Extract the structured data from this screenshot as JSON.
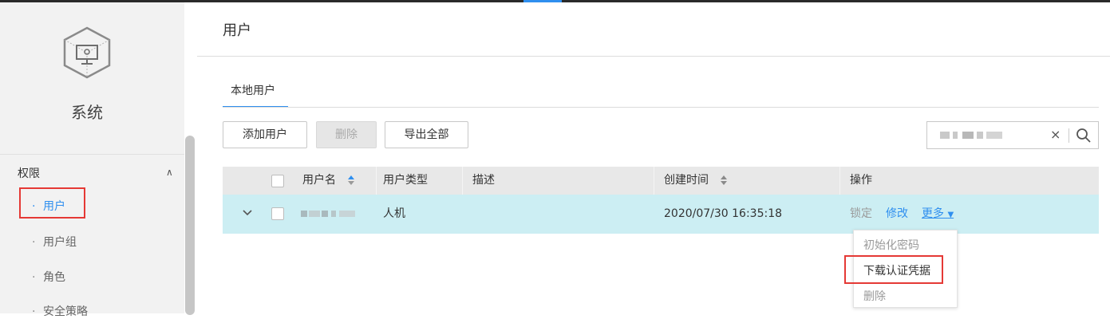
{
  "sidebar": {
    "system_title": "系统",
    "group_label": "权限",
    "items": [
      {
        "label": "用户",
        "active": true
      },
      {
        "label": "用户组",
        "active": false
      },
      {
        "label": "角色",
        "active": false
      },
      {
        "label": "安全策略",
        "active": false
      }
    ]
  },
  "page": {
    "title": "用户",
    "tab_label": "本地用户"
  },
  "toolbar": {
    "add_label": "添加用户",
    "delete_label": "删除",
    "export_label": "导出全部"
  },
  "search": {
    "value": "",
    "clear_icon": "×"
  },
  "table": {
    "headers": [
      "用户名",
      "用户类型",
      "描述",
      "创建时间",
      "操作"
    ],
    "rows": [
      {
        "username": "",
        "type": "人机",
        "description": "",
        "created": "2020/07/30 16:35:18",
        "ops": {
          "lock": "锁定",
          "edit": "修改",
          "more": "更多"
        }
      }
    ]
  },
  "more_menu": {
    "items": [
      {
        "label": "初始化密码",
        "enabled": false
      },
      {
        "label": "下载认证凭据",
        "enabled": true
      },
      {
        "label": "删除",
        "enabled": false
      }
    ]
  },
  "colors": {
    "accent": "#2f8fef",
    "highlight_box": "#e53935",
    "row_selected": "#cceef3"
  }
}
